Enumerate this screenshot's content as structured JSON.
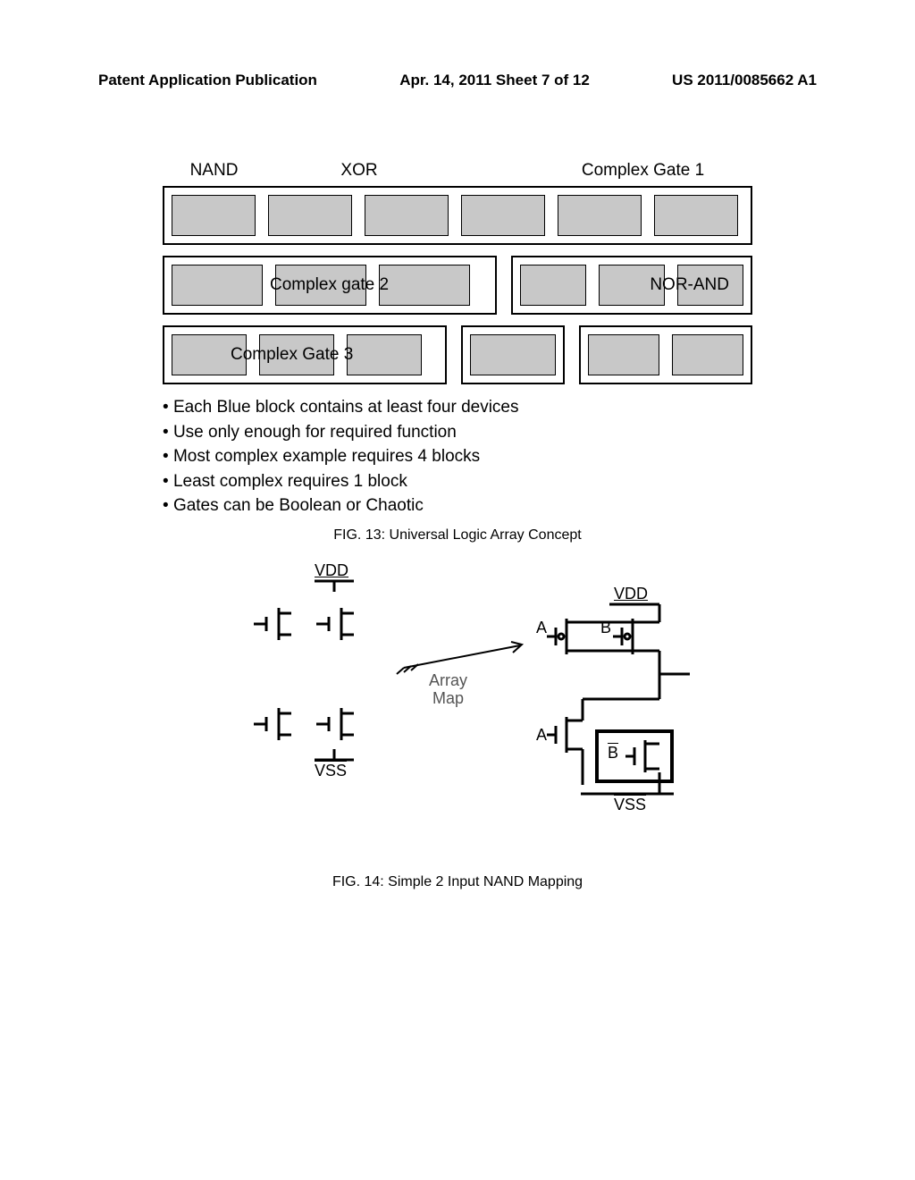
{
  "header": {
    "left": "Patent Application Publication",
    "mid": "Apr. 14, 2011  Sheet 7 of 12",
    "right": "US 2011/0085662 A1"
  },
  "fig13": {
    "labels": {
      "nand": "NAND",
      "xor": "XOR",
      "cg1": "Complex Gate 1",
      "cg2": "Complex gate 2",
      "norand": "NOR-AND",
      "cg3": "Complex Gate 3"
    },
    "bullets": [
      "Each Blue block contains at least four devices",
      "Use only enough for required function",
      "Most complex example requires 4 blocks",
      "Least complex requires 1 block",
      "Gates can be Boolean or Chaotic"
    ],
    "caption": "FIG. 13: Universal Logic Array Concept"
  },
  "fig14": {
    "vdd": "VDD",
    "vss": "VSS",
    "array_map": "Array\nMap",
    "A": "A",
    "B": "B",
    "Bbar": "B",
    "caption": "FIG. 14: Simple 2 Input NAND Mapping"
  },
  "chart_data": [
    {
      "type": "diagram",
      "title": "Universal Logic Array Concept",
      "description": "Grid of rectangular gray device-blocks grouped and labeled as logic gates.",
      "rows": [
        {
          "groups": [
            {
              "label": "NAND",
              "blocks": 1
            },
            {
              "label": "XOR",
              "blocks": 2
            },
            {
              "label": "(unlabeled)",
              "blocks": 1
            },
            {
              "label": "Complex Gate 1",
              "blocks": 2
            }
          ]
        },
        {
          "groups": [
            {
              "label": "Complex gate 2",
              "blocks": 3
            },
            {
              "label": "(unlabeled)",
              "blocks": 1
            },
            {
              "label": "NOR-AND",
              "blocks": 2
            }
          ]
        },
        {
          "groups": [
            {
              "label": "Complex Gate 3",
              "blocks": 3
            },
            {
              "label": "(unlabeled)",
              "blocks": 1
            },
            {
              "label": "(unlabeled)",
              "blocks": 2
            }
          ]
        }
      ],
      "notes": [
        "Each Blue block contains at least four devices",
        "Use only enough for required function",
        "Most complex example requires 4 blocks",
        "Least complex requires 1 block",
        "Gates can be Boolean or Chaotic"
      ]
    },
    {
      "type": "diagram",
      "title": "Simple 2 Input NAND Mapping",
      "left_schematic": {
        "rail_top": "VDD",
        "rail_bottom": "VSS",
        "transistors": 4,
        "arrangement": "2x2 unconnected MOS symbols"
      },
      "mapping_arrow_label": "Array Map",
      "right_schematic": {
        "rail_top": "VDD",
        "rail_bottom": "VSS",
        "pull_up": {
          "type": "PMOS parallel",
          "inputs": [
            "A",
            "B"
          ]
        },
        "pull_down": {
          "type": "NMOS series",
          "inputs": [
            "A",
            "B̄"
          ]
        },
        "function": "2-input NAND"
      }
    }
  ]
}
